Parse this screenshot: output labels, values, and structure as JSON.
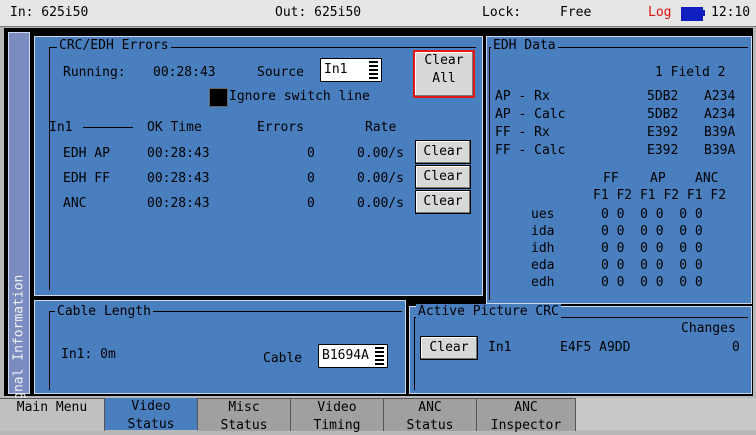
{
  "topbar": {
    "input": "In: 625i50",
    "output": "Out: 625i50",
    "lock_label": "Lock:",
    "lock_value": "Free",
    "log": "Log",
    "time": "12:10",
    "battery_icon": "battery-icon",
    "log_color": "#e01010"
  },
  "side_tab": "Signal Information",
  "crc": {
    "title": "CRC/EDH Errors",
    "running_label": "Running:",
    "running_value": "00:28:43",
    "source_label": "Source",
    "source_value": "In1",
    "clear_all": [
      "Clear",
      "All"
    ],
    "ignore_label": "Ignore switch line",
    "section": "In1",
    "headers": [
      "OK Time",
      "Errors",
      "Rate"
    ],
    "rows": [
      {
        "name": "EDH AP",
        "ok_time": "00:28:43",
        "errors": "0",
        "rate": "0.00/s",
        "button": "Clear"
      },
      {
        "name": "EDH FF",
        "ok_time": "00:28:43",
        "errors": "0",
        "rate": "0.00/s",
        "button": "Clear"
      },
      {
        "name": "ANC",
        "ok_time": "00:28:43",
        "errors": "0",
        "rate": "0.00/s",
        "button": "Clear"
      }
    ]
  },
  "edh": {
    "title": "EDH Data",
    "field_header": "1 Field 2",
    "rows": [
      {
        "label": "AP - Rx",
        "f1": "5DB2",
        "f2": "A234"
      },
      {
        "label": "AP - Calc",
        "f1": "5DB2",
        "f2": "A234"
      },
      {
        "label": "FF - Rx",
        "f1": "E392",
        "f2": "B39A"
      },
      {
        "label": "FF - Calc",
        "f1": "E392",
        "f2": "B39A"
      }
    ],
    "group_headers": [
      "FF",
      "AP",
      "ANC"
    ],
    "sub_header": "F1 F2 F1 F2 F1 F2",
    "flag_rows": [
      {
        "label": "ues",
        "values": "0 0  0 0  0 0"
      },
      {
        "label": "ida",
        "values": "0 0  0 0  0 0"
      },
      {
        "label": "idh",
        "values": "0 0  0 0  0 0"
      },
      {
        "label": "eda",
        "values": "0 0  0 0  0 0"
      },
      {
        "label": "edh",
        "values": "0 0  0 0  0 0"
      }
    ]
  },
  "cable": {
    "title": "Cable Length",
    "value": "In1: 0m",
    "label": "Cable",
    "selected": "B1694A"
  },
  "active_crc": {
    "title": "Active Picture CRC",
    "changes_label": "Changes",
    "button": "Clear",
    "input": "In1",
    "crc_value": "E4F5 A9DD",
    "changes_value": "0"
  },
  "menu": [
    {
      "line1": "Main Menu",
      "line2": ""
    },
    {
      "line1": "Video",
      "line2": "Status"
    },
    {
      "line1": "Misc",
      "line2": "Status"
    },
    {
      "line1": "Video",
      "line2": "Timing"
    },
    {
      "line1": "ANC",
      "line2": "Status"
    },
    {
      "line1": "ANC",
      "line2": "Inspector"
    }
  ]
}
